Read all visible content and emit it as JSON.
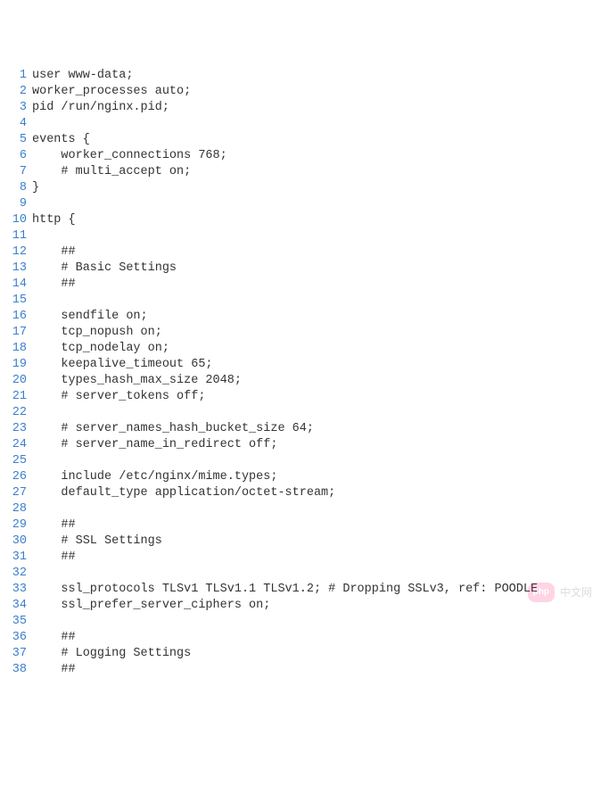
{
  "lines": [
    {
      "n": 1,
      "text": "user www-data;"
    },
    {
      "n": 2,
      "text": "worker_processes auto;"
    },
    {
      "n": 3,
      "text": "pid /run/nginx.pid;"
    },
    {
      "n": 4,
      "text": ""
    },
    {
      "n": 5,
      "text": "events {"
    },
    {
      "n": 6,
      "text": "    worker_connections 768;"
    },
    {
      "n": 7,
      "text": "    # multi_accept on;"
    },
    {
      "n": 8,
      "text": "}"
    },
    {
      "n": 9,
      "text": ""
    },
    {
      "n": 10,
      "text": "http {"
    },
    {
      "n": 11,
      "text": ""
    },
    {
      "n": 12,
      "text": "    ##"
    },
    {
      "n": 13,
      "text": "    # Basic Settings"
    },
    {
      "n": 14,
      "text": "    ##"
    },
    {
      "n": 15,
      "text": ""
    },
    {
      "n": 16,
      "text": "    sendfile on;"
    },
    {
      "n": 17,
      "text": "    tcp_nopush on;"
    },
    {
      "n": 18,
      "text": "    tcp_nodelay on;"
    },
    {
      "n": 19,
      "text": "    keepalive_timeout 65;"
    },
    {
      "n": 20,
      "text": "    types_hash_max_size 2048;"
    },
    {
      "n": 21,
      "text": "    # server_tokens off;"
    },
    {
      "n": 22,
      "text": ""
    },
    {
      "n": 23,
      "text": "    # server_names_hash_bucket_size 64;"
    },
    {
      "n": 24,
      "text": "    # server_name_in_redirect off;"
    },
    {
      "n": 25,
      "text": ""
    },
    {
      "n": 26,
      "text": "    include /etc/nginx/mime.types;"
    },
    {
      "n": 27,
      "text": "    default_type application/octet-stream;"
    },
    {
      "n": 28,
      "text": ""
    },
    {
      "n": 29,
      "text": "    ##"
    },
    {
      "n": 30,
      "text": "    # SSL Settings"
    },
    {
      "n": 31,
      "text": "    ##"
    },
    {
      "n": 32,
      "text": ""
    },
    {
      "n": 33,
      "text": "    ssl_protocols TLSv1 TLSv1.1 TLSv1.2; # Dropping SSLv3, ref: POODLE"
    },
    {
      "n": 34,
      "text": "    ssl_prefer_server_ciphers on;"
    },
    {
      "n": 35,
      "text": ""
    },
    {
      "n": 36,
      "text": "    ##"
    },
    {
      "n": 37,
      "text": "    # Logging Settings"
    },
    {
      "n": 38,
      "text": "    ##"
    }
  ],
  "watermark": {
    "badge": "php",
    "text": "中文网"
  }
}
